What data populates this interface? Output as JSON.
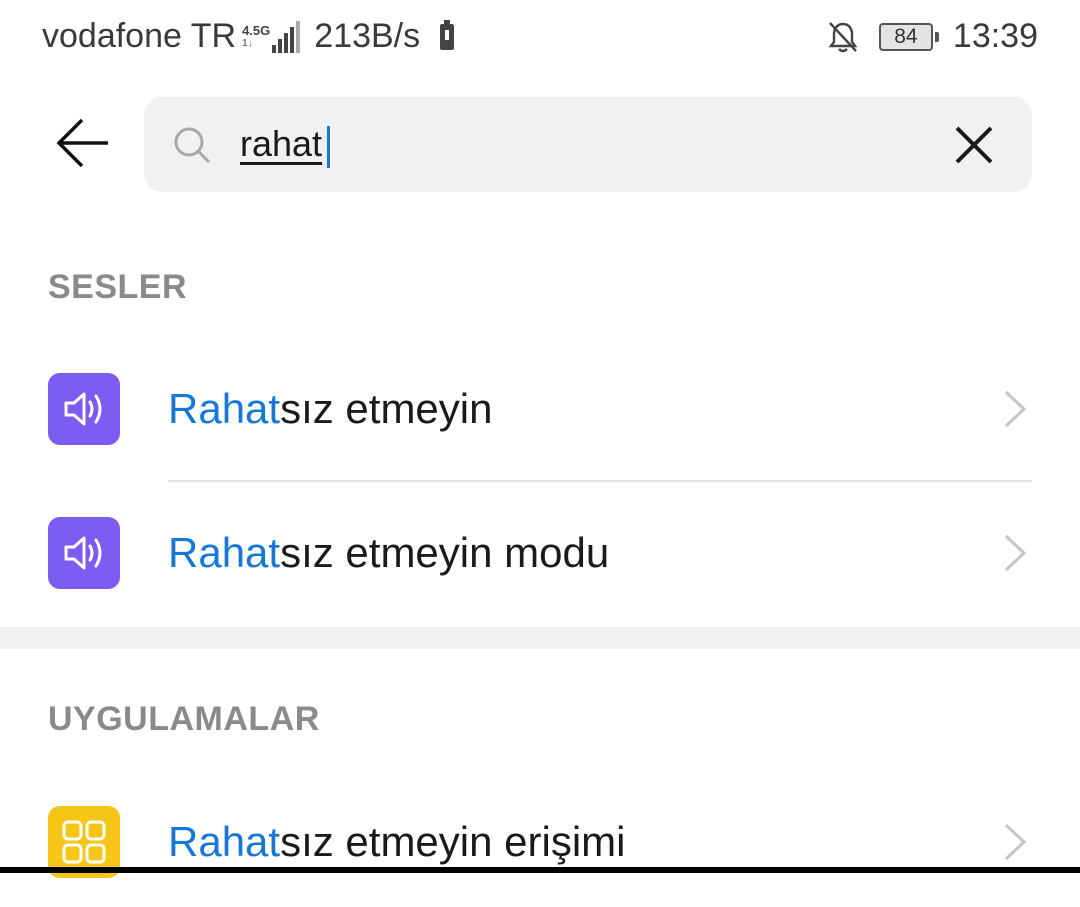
{
  "status_bar": {
    "carrier": "vodafone TR",
    "network_type": "4.5G",
    "network_sub": "1↓",
    "speed": "213B/s",
    "battery_level": "84",
    "time": "13:39",
    "icons": [
      "signal-icon",
      "battery-saver-icon",
      "notifications-off-icon",
      "battery-icon"
    ]
  },
  "search": {
    "query": "rahat",
    "icon": "search-icon",
    "clear_icon": "close-icon",
    "back_icon": "arrow-left-icon"
  },
  "sections": [
    {
      "title": "SESLER",
      "items": [
        {
          "highlight": "Rahat",
          "rest": "sız etmeyin",
          "icon": "speaker-icon",
          "icon_color": "#7b5cf0"
        },
        {
          "highlight": "Rahat",
          "rest": "sız etmeyin modu",
          "icon": "speaker-icon",
          "icon_color": "#7b5cf0"
        }
      ]
    },
    {
      "title": "UYGULAMALAR",
      "items": [
        {
          "highlight": "Rahat",
          "rest": "sız etmeyin erişimi",
          "icon": "apps-grid-icon",
          "icon_color": "#f5c518"
        }
      ]
    }
  ],
  "colors": {
    "highlight": "#1677d9",
    "section_title": "#8a8a8a",
    "search_bg": "#f1f1f1"
  }
}
